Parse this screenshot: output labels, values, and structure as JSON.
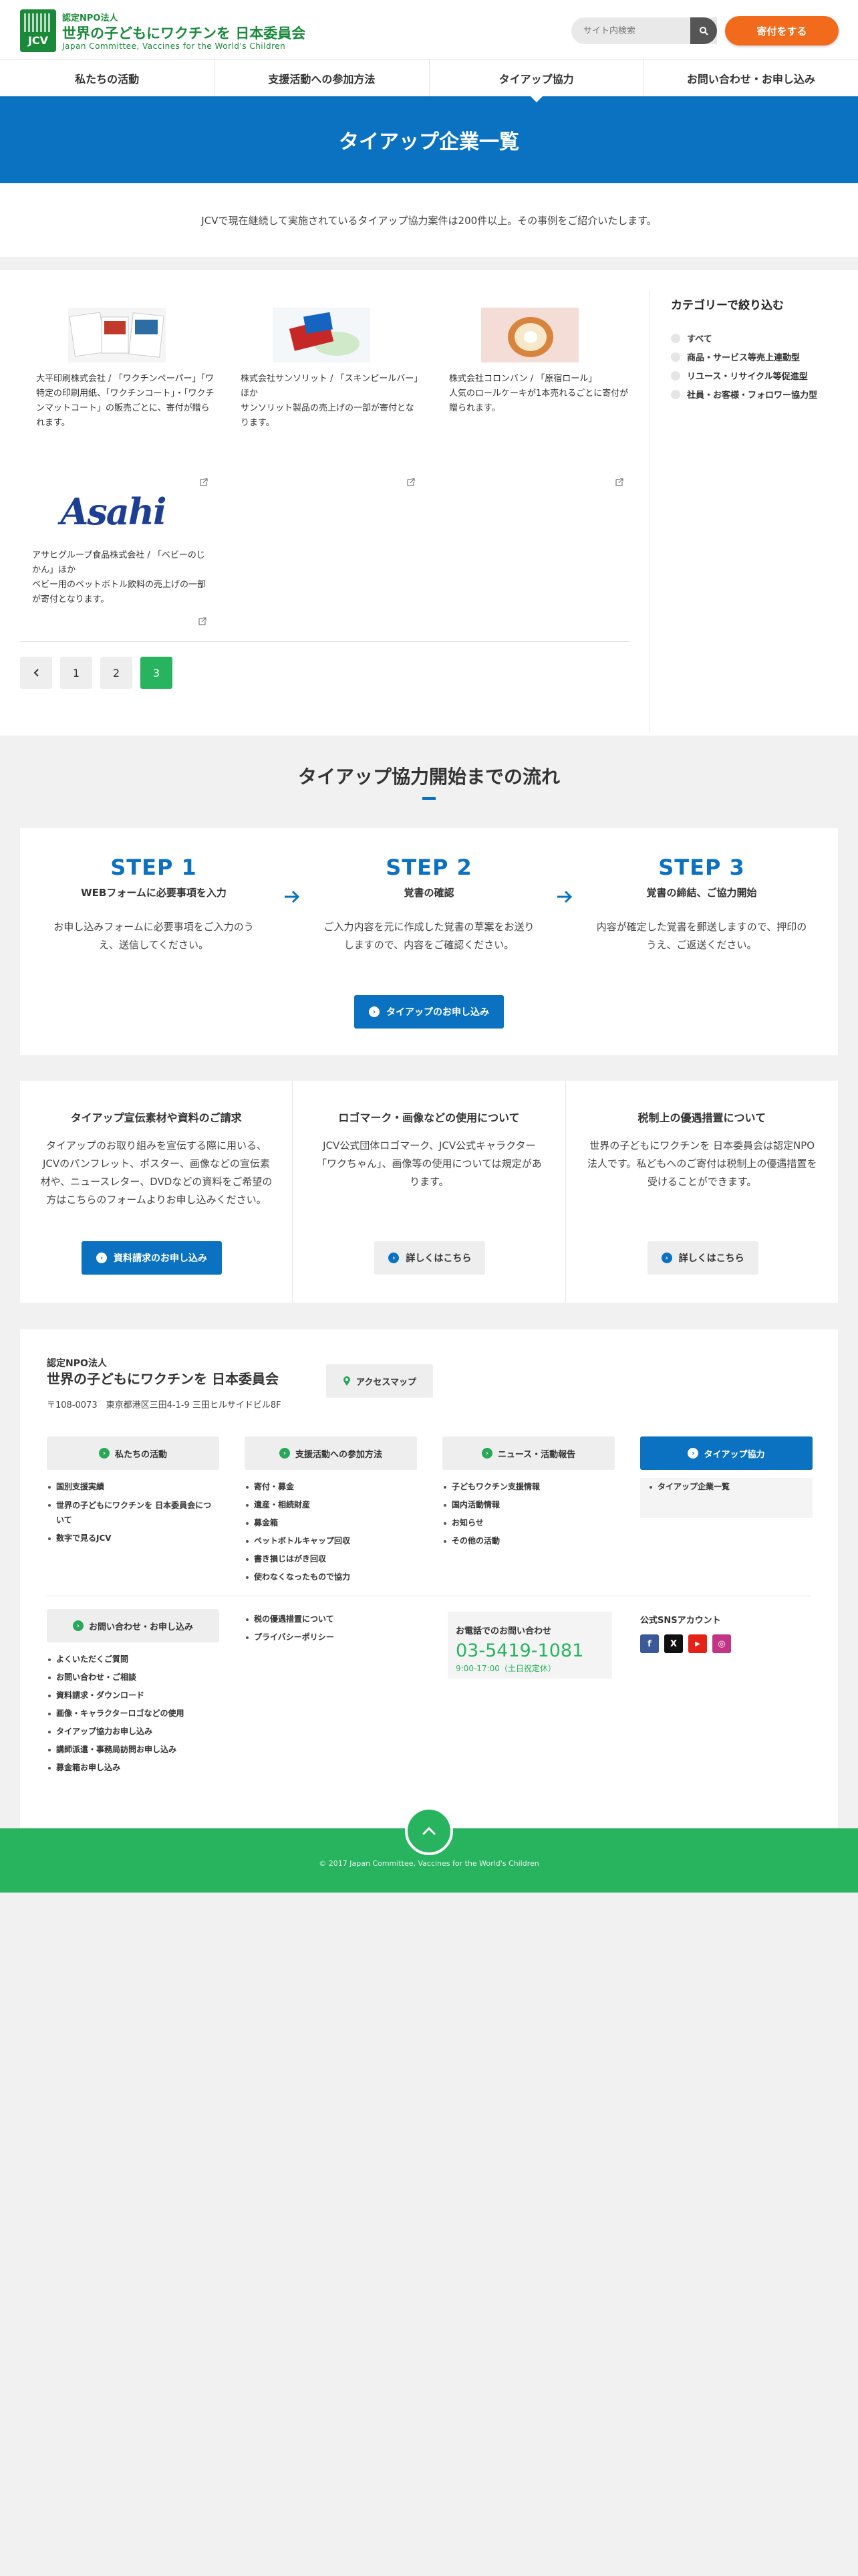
{
  "header": {
    "org_type": "認定NPO法人",
    "org_name": "世界の子どもにワクチンを 日本委員会",
    "org_en": "Japan Committee, Vaccines for the World's Children",
    "logo_text": "JCV",
    "search_placeholder": "サイト内検索",
    "donate_label": "寄付をする"
  },
  "nav": [
    {
      "label": "私たちの活動"
    },
    {
      "label": "支援活動への参加方法"
    },
    {
      "label": "タイアップ協力"
    },
    {
      "label": "お問い合わせ・お申し込み"
    }
  ],
  "page_title": "タイアップ企業一覧",
  "intro": "JCVで現在継続して実施されているタイアップ協力案件は200件以上。その事例をご紹介いたします。",
  "cards": [
    {
      "title": "大平印刷株式会社 / 「ワクチンペーパー」「ワクチンコート」・「ワクチンマットコート」",
      "desc": "特定の印刷用紙、「ワクチンコート」・「ワクチンマットコート」の販売ごとに、寄付が贈られます。"
    },
    {
      "title": "株式会社サンソリット / 「スキンピールバー」ほか",
      "desc": "サンソリット製品の売上げの一部が寄付となります。"
    },
    {
      "title": "株式会社コロンバン / 「原宿ロール」",
      "desc": "人気のロールケーキが1本売れるごとに寄付が贈られます。"
    },
    {
      "title": "アサヒグループ食品株式会社 / 「ベビーのじかん」ほか",
      "desc": "ベビー用のペットボトル飲料の売上げの一部が寄付となります。",
      "logo_text": "Asahi"
    }
  ],
  "pagination": [
    "1",
    "2",
    "3"
  ],
  "categories": {
    "title": "カテゴリーで絞り込む",
    "items": [
      "すべて",
      "商品・サービス等売上連動型",
      "リユース・リサイクル等促進型",
      "社員・お客様・フォロワー協力型"
    ]
  },
  "flow": {
    "title": "タイアップ協力開始までの流れ",
    "steps": [
      {
        "head": "STEP 1",
        "title": "WEBフォームに必要事項を入力",
        "desc": "お申し込みフォームに必要事項をご入力のうえ、送信してください。"
      },
      {
        "head": "STEP 2",
        "title": "覚書の確認",
        "desc": "ご入力内容を元に作成した覚書の草案をお送りしますので、内容をご確認ください。"
      },
      {
        "head": "STEP 3",
        "title": "覚書の締結、ご協力開始",
        "desc": "内容が確定した覚書を郵送しますので、押印のうえ、ご返送ください。"
      }
    ],
    "apply_label": "タイアップのお申し込み"
  },
  "infos": [
    {
      "title": "タイアップ宣伝素材や資料のご請求",
      "desc": "タイアップのお取り組みを宣伝する際に用いる、JCVのパンフレット、ポスター、画像などの宣伝素材や、ニュースレター、DVDなどの資料をご希望の方はこちらのフォームよりお申し込みください。",
      "btn": "資料請求のお申し込み"
    },
    {
      "title": "ロゴマーク・画像などの使用について",
      "desc": "JCV公式団体ロゴマーク、JCV公式キャラクター「ワクちゃん」、画像等の使用については規定があります。",
      "btn": "詳しくはこちら"
    },
    {
      "title": "税制上の優遇措置について",
      "desc": "世界の子どもにワクチンを 日本委員会は認定NPO法人です。私どもへのご寄付は税制上の優遇措置を受けることができます。",
      "btn": "詳しくはこちら"
    }
  ],
  "footer": {
    "org_type": "認定NPO法人",
    "org_name": "世界の子どもにワクチンを 日本委員会",
    "address": "〒108-0073　東京都港区三田4-1-9 三田ヒルサイドビル8F",
    "access_label": "アクセスマップ",
    "sections": [
      {
        "head": "私たちの活動",
        "items": [
          "国別支援実績",
          "世界の子どもにワクチンを 日本委員会について",
          "数字で見るJCV"
        ]
      },
      {
        "head": "支援活動への参加方法",
        "items": [
          "寄付・募金",
          "遺産・相続財産",
          "募金箱",
          "ペットボトルキャップ回収",
          "書き損じはがき回収",
          "使わなくなったもので協力"
        ]
      },
      {
        "head": "ニュース・活動報告",
        "items": [
          "子どもワクチン支援情報",
          "国内活動情報",
          "お知らせ",
          "その他の活動"
        ]
      },
      {
        "head": "タイアップ協力",
        "items": [
          "タイアップ企業一覧"
        ]
      },
      {
        "head": "お問い合わせ・お申し込み",
        "items": [
          "よくいただくご質問",
          "お問い合わせ・ご相談",
          "資料請求・ダウンロード",
          "画像・キャラクターロゴなどの使用",
          "タイアップ協力お申し込み",
          "講師派遣・事務局訪問お申し込み",
          "募金箱お申し込み"
        ]
      }
    ],
    "misc_links": [
      "税の優遇措置について",
      "プライバシーポリシー"
    ],
    "phone_label": "お電話でのお問い合わせ",
    "phone": "03-5419-1081",
    "hours": "9:00-17:00（土日祝定休）",
    "sns_title": "公式SNSアカウント",
    "sns": [
      "f",
      "X",
      "▶",
      "◎"
    ],
    "copyright": "© 2017 Japan Committee, Vaccines for the World's Children"
  }
}
